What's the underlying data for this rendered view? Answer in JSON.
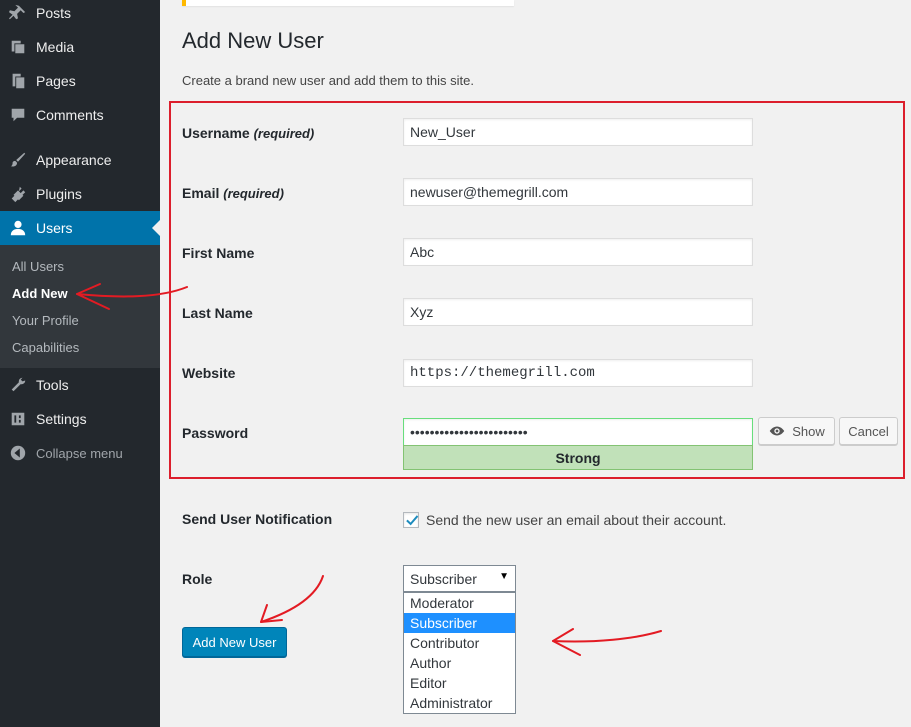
{
  "sidebar": {
    "items": [
      {
        "label": "Posts",
        "icon": "pin-icon"
      },
      {
        "label": "Media",
        "icon": "media-icon"
      },
      {
        "label": "Pages",
        "icon": "pages-icon"
      },
      {
        "label": "Comments",
        "icon": "comment-icon"
      },
      {
        "label": "Appearance",
        "icon": "brush-icon"
      },
      {
        "label": "Plugins",
        "icon": "plug-icon"
      },
      {
        "label": "Users",
        "icon": "user-icon",
        "active": true
      },
      {
        "label": "Tools",
        "icon": "wrench-icon"
      },
      {
        "label": "Settings",
        "icon": "settings-icon"
      },
      {
        "label": "Collapse menu",
        "icon": "collapse-icon"
      }
    ],
    "submenu": [
      "All Users",
      "Add New",
      "Your Profile",
      "Capabilities"
    ],
    "current_submenu": "Add New"
  },
  "page": {
    "title": "Add New User",
    "description": "Create a brand new user and add them to this site."
  },
  "form": {
    "username": {
      "label": "Username",
      "required": "(required)",
      "value": "New_User"
    },
    "email": {
      "label": "Email",
      "required": "(required)",
      "value": "newuser@themegrill.com"
    },
    "first_name": {
      "label": "First Name",
      "value": "Abc"
    },
    "last_name": {
      "label": "Last Name",
      "value": "Xyz"
    },
    "website": {
      "label": "Website",
      "value": "https://themegrill.com"
    },
    "password": {
      "label": "Password",
      "value": "••••••••••••••••••••••••",
      "strength": "Strong",
      "show_label": "Show",
      "cancel_label": "Cancel"
    },
    "notification": {
      "label": "Send User Notification",
      "checked": true,
      "text": "Send the new user an email about their account."
    },
    "role": {
      "label": "Role",
      "selected": "Subscriber",
      "options": [
        "Moderator",
        "Subscriber",
        "Contributor",
        "Author",
        "Editor",
        "Administrator"
      ]
    },
    "submit_label": "Add New User"
  },
  "colors": {
    "sidebar_bg": "#23282d",
    "active_menu": "#0073aa",
    "primary_button": "#0085ba",
    "highlight_box": "#dc1e2c",
    "strength_good": "#c1e1b9",
    "annotation_arrow": "#e31b23"
  }
}
